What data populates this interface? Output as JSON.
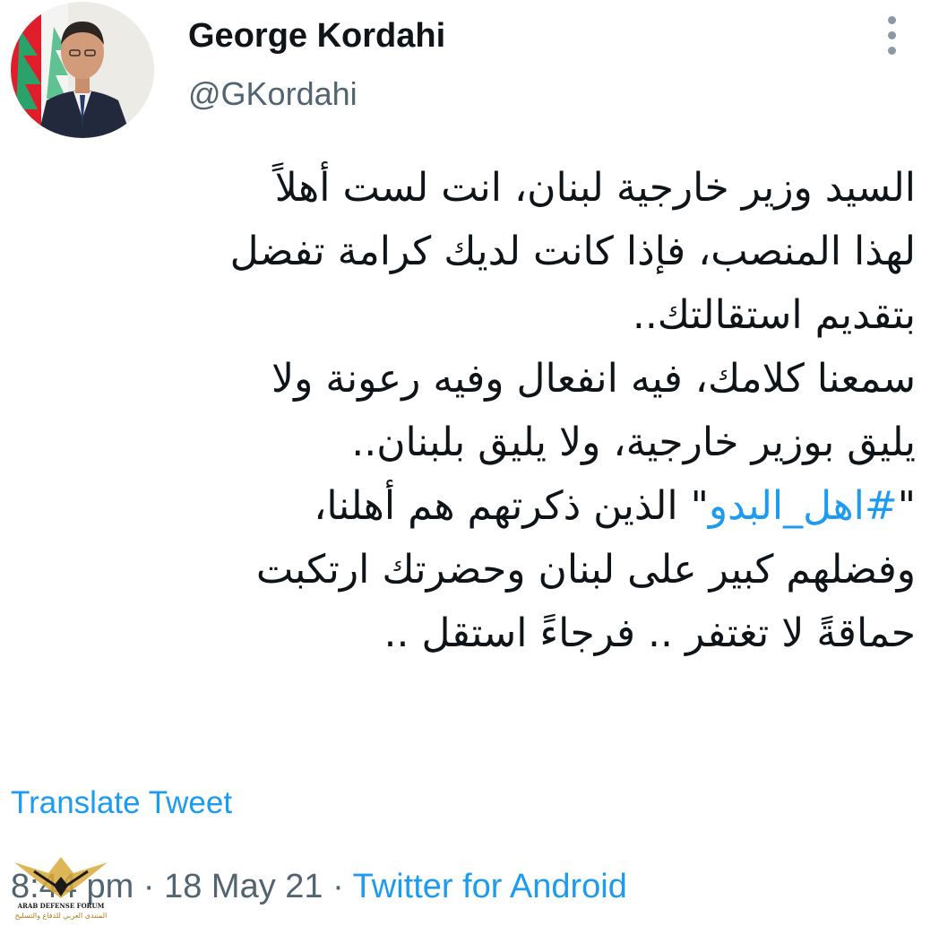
{
  "author": {
    "name": "George Kordahi",
    "handle": "@GKordahi",
    "avatar_icon": "profile-photo-with-lebanese-flag"
  },
  "more_icon": "vertical-ellipsis-icon",
  "tweet": {
    "lines": [
      {
        "text": "السيد وزير خارجية لبنان، انت لست أهلاً"
      },
      {
        "text": "لهذا المنصب، فإذا كانت لديك كرامة تفضل"
      },
      {
        "text": "بتقديم استقالتك.."
      },
      {
        "text": "سمعنا كلامك، فيه انفعال وفيه رعونة ولا"
      },
      {
        "text": "يليق بوزير خارجية، ولا يليق بلبنان.."
      },
      {
        "prefix": "\"",
        "hashtag": "#اهل_البدو",
        "suffix": "\" الذين ذكرتهم هم أهلنا،"
      },
      {
        "text": "وفضلهم كبير على لبنان وحضرتك ارتكبت"
      },
      {
        "text": "حماقةً لا تغتفر .. فرجاءً استقل .."
      }
    ]
  },
  "translate_label": "Translate Tweet",
  "meta": {
    "time": "8:44 pm",
    "separator": " · ",
    "date": "18 May 21",
    "source": "Twitter for Android"
  },
  "watermark": {
    "line1": "ARAB DEFENSE FORUM",
    "line2": "المنتدى العربي للدفاع والتسليح",
    "icon": "eagle-emblem-icon"
  },
  "colors": {
    "link": "#1d9bf0",
    "secondary": "#536471",
    "text": "#0f1419",
    "flag_red": "#e01e2b",
    "cedar_green": "#2aa36b"
  }
}
